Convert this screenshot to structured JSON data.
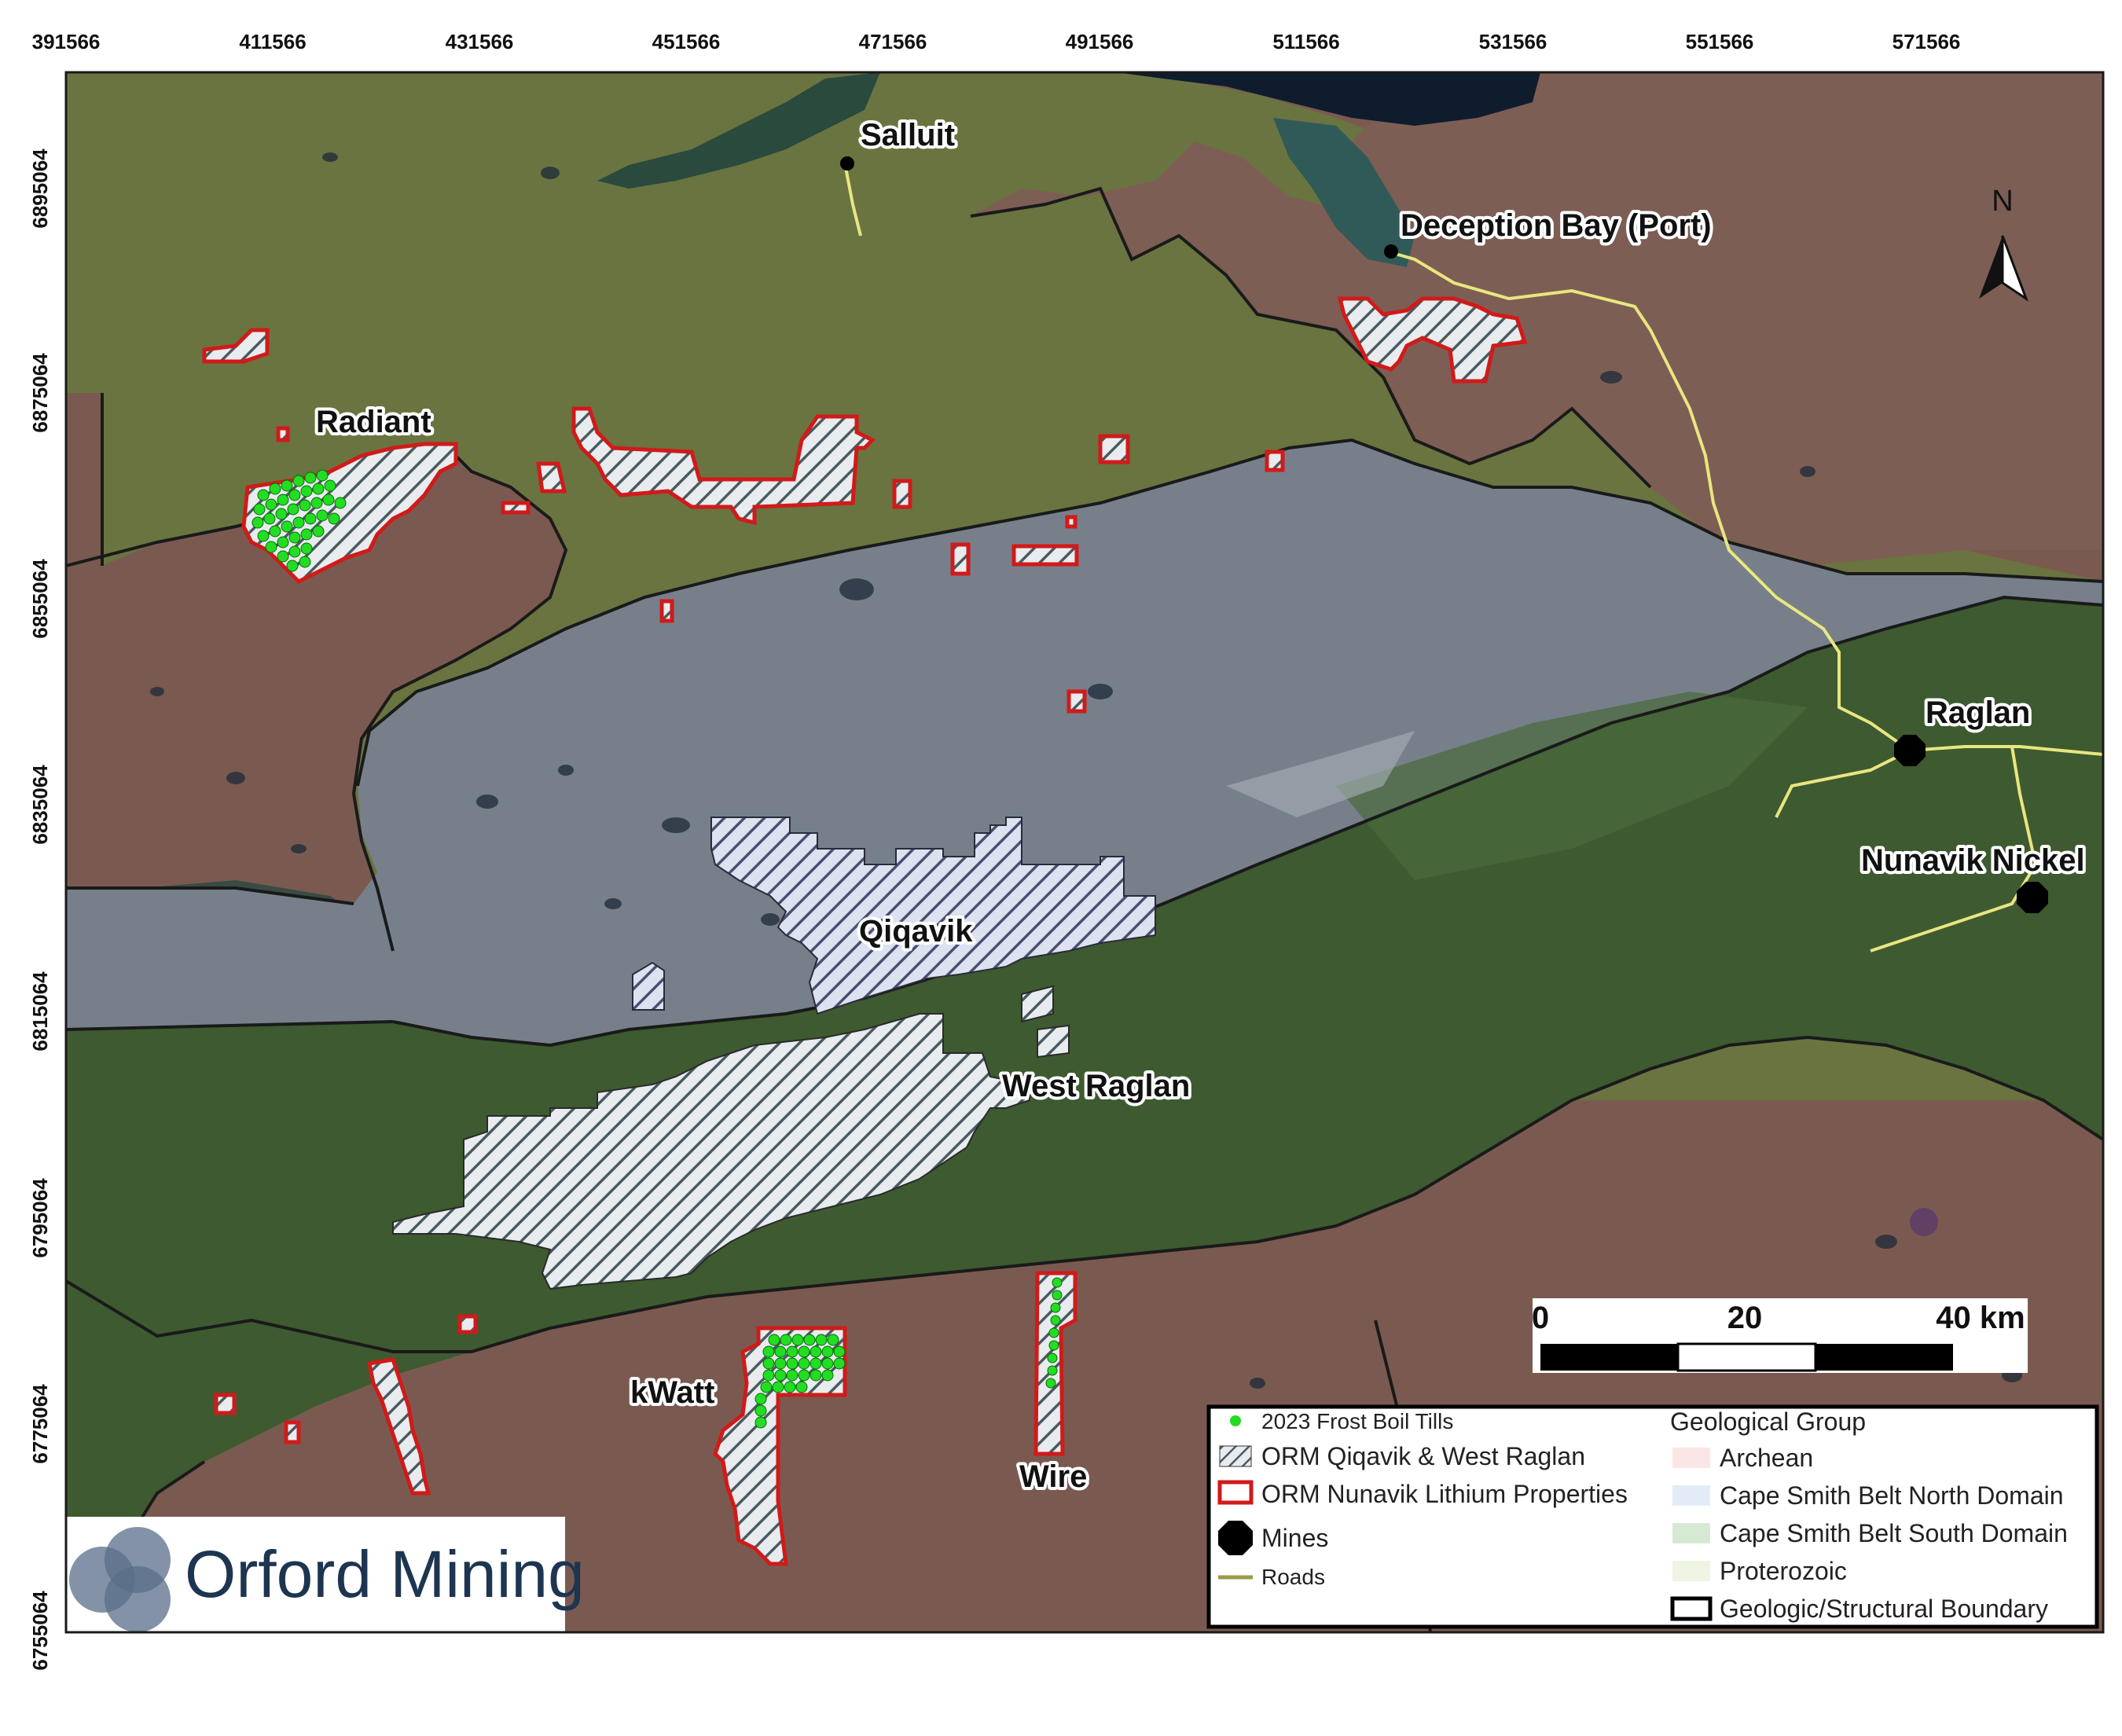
{
  "map": {
    "x_ticks": [
      "391566",
      "411566",
      "431566",
      "451566",
      "471566",
      "491566",
      "511566",
      "531566",
      "551566",
      "571566"
    ],
    "y_ticks": [
      "6895064",
      "6875064",
      "6855064",
      "6835064",
      "6815064",
      "6795064",
      "6775064",
      "6755064"
    ],
    "places": {
      "salluit": "Salluit",
      "deception_bay": "Deception Bay (Port)",
      "radiant": "Radiant",
      "qiqavik": "Qiqavik",
      "west_raglan": "West Raglan",
      "raglan": "Raglan",
      "nunavik_nickel": "Nunavik Nickel",
      "kwatt": "kWatt",
      "wire": "Wire"
    },
    "north_label": "N",
    "scale": {
      "labels": [
        "0",
        "20",
        "40 km"
      ]
    },
    "logo_text": "Orford Mining",
    "colors": {
      "archean": "#7a5a50",
      "north_domain": "#77808a",
      "south_domain": "#3e5a30",
      "proterozoic": "#6a7440",
      "water": "#1a2a3a",
      "property_outline": "#d11a1a",
      "frost_boil": "#22dd22",
      "road": "#e8e680"
    }
  },
  "legend": {
    "left_items": [
      {
        "icon": "frost-boil-dot-icon",
        "label": "2023 Frost Boil Tills"
      },
      {
        "icon": "hatched-box-icon",
        "label": "ORM Qiqavik & West Raglan"
      },
      {
        "icon": "red-outline-box-icon",
        "label": "ORM Nunavik Lithium Properties"
      },
      {
        "icon": "mine-octagon-icon",
        "label": "Mines"
      },
      {
        "icon": "road-line-icon",
        "label": "Roads"
      }
    ],
    "group_title": "Geological Group",
    "right_items": [
      {
        "label": "Archean",
        "color": "#fbe6e6"
      },
      {
        "label": "Cape Smith Belt North Domain",
        "color": "#e3ecf6"
      },
      {
        "label": "Cape Smith Belt South Domain",
        "color": "#d6ead3"
      },
      {
        "label": "Proterozoic",
        "color": "#eef5e2"
      },
      {
        "label": "Geologic/Structural Boundary",
        "color": "#ffffff"
      }
    ]
  }
}
